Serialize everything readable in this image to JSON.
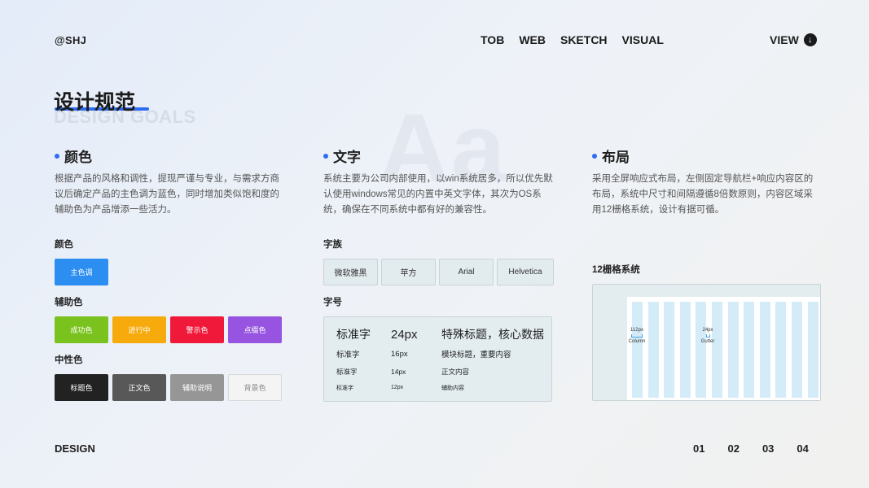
{
  "header": {
    "brand": "@SHJ",
    "nav": [
      "TOB",
      "WEB",
      "SKETCH",
      "VISUAL"
    ],
    "view_label": "VIEW",
    "view_icon": "↓"
  },
  "title": {
    "cn": "设计规范",
    "en": "DESIGN GOALS"
  },
  "decor": {
    "aa": "Aa"
  },
  "colors": {
    "heading": "颜色",
    "desc": "根据产品的风格和调性，提现严谨与专业，与需求方商议后确定产品的主色调为蓝色，同时增加类似饱和度的辅助色为产品增添一些活力。",
    "primary_label": "颜色",
    "primary": [
      {
        "name": "主色调",
        "color": "#2b8ef0"
      }
    ],
    "aux_label": "辅助色",
    "aux": [
      {
        "name": "成功色",
        "color": "#7ac31f"
      },
      {
        "name": "进行中",
        "color": "#f7aa0c"
      },
      {
        "name": "警示色",
        "color": "#f0193a"
      },
      {
        "name": "点缀色",
        "color": "#9654e0"
      }
    ],
    "neutral_label": "中性色",
    "neutral": [
      {
        "name": "标题色",
        "color": "#222222",
        "text": "#ffffff"
      },
      {
        "name": "正文色",
        "color": "#585858",
        "text": "#ffffff"
      },
      {
        "name": "辅助说明",
        "color": "#969696",
        "text": "#ffffff"
      },
      {
        "name": "背景色",
        "color": "#f4f4f4",
        "text": "#888888"
      }
    ]
  },
  "text": {
    "heading": "文字",
    "desc": "系统主要为公司内部使用，以win系统居多，所以优先默认使用windows常见的内置中英文字体，其次为OS系统，确保在不同系统中都有好的兼容性。",
    "family_label": "字族",
    "families": [
      "微软雅黑",
      "苹方",
      "Arial",
      "Helvetica"
    ],
    "size_label": "字号",
    "sizes": [
      {
        "name": "标准字",
        "px": "24px",
        "use": "特殊标题，核心数据"
      },
      {
        "name": "标准字",
        "px": "16px",
        "use": "模块标题，重要内容"
      },
      {
        "name": "标准字",
        "px": "14px",
        "use": "正文内容"
      },
      {
        "name": "标准字",
        "px": "12px",
        "use": "辅助内容"
      }
    ]
  },
  "layout": {
    "heading": "布局",
    "desc": "采用全屏响应式布局，左侧固定导航栏+响应内容区的布局，系统中尺寸和间隔遵循8倍数原则，内容区域采用12栅格系统，设计有据可循。",
    "grid_label": "12栅格系统",
    "column_count": 12,
    "column_marker": {
      "size": "112px",
      "name": "Column"
    },
    "gutter_marker": {
      "size": "24px",
      "name": "Gutter"
    }
  },
  "footer": {
    "left": "DESIGN",
    "pages": [
      "01",
      "02",
      "03",
      "04"
    ]
  }
}
